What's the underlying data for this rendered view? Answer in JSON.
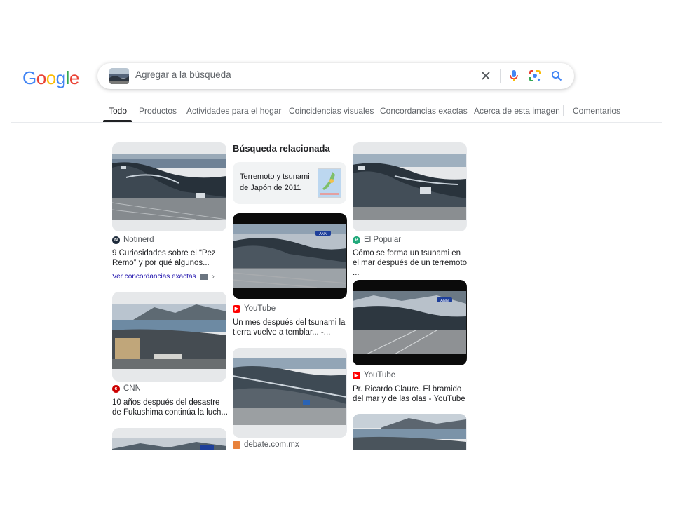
{
  "logo": {
    "letters": [
      "G",
      "o",
      "o",
      "g",
      "l",
      "e"
    ]
  },
  "search": {
    "placeholder": "Agregar a la búsqueda",
    "clear_icon": "close-icon",
    "voice_icon": "microphone-icon",
    "lens_icon": "lens-icon",
    "search_icon": "search-icon"
  },
  "colors": {
    "blue": "#4285f4",
    "red": "#ea4335",
    "yellow": "#fbbc05",
    "green": "#34a853",
    "link": "#1a0dab"
  },
  "tabs": [
    {
      "label": "Todo"
    },
    {
      "label": "Productos"
    },
    {
      "label": "Actividades para el hogar"
    },
    {
      "label": "Coincidencias visuales"
    },
    {
      "label": "Concordancias exactas"
    },
    {
      "label": "Acerca de esta imagen"
    },
    {
      "label": "Comentarios"
    }
  ],
  "related": {
    "heading": "Búsqueda relacionada",
    "text": "Terremoto y tsunami de Japón de 2011"
  },
  "results": {
    "r1": {
      "source": "Notinerd",
      "title": "9 Curiosidades sobre el “Pez Remo” y por qué algunos...",
      "exact_link": "Ver concordancias exactas"
    },
    "r2": {
      "source": "CNN",
      "title": "10 años después del desastre de Fukushima continúa la luch..."
    },
    "r3": {
      "source": "YouTube",
      "title": "Un mes después del tsunami la tierra vuelve a temblar... -..."
    },
    "r4": {
      "source": "debate.com.mx"
    },
    "r5": {
      "source": "El Popular",
      "title": "Cómo se forma un tsunami en el mar después de un terremoto ..."
    },
    "r6": {
      "source": "YouTube",
      "title": "Pr. Ricardo Claure. El bramido del mar y de las olas - YouTube"
    },
    "ann_badge": "ANN"
  }
}
